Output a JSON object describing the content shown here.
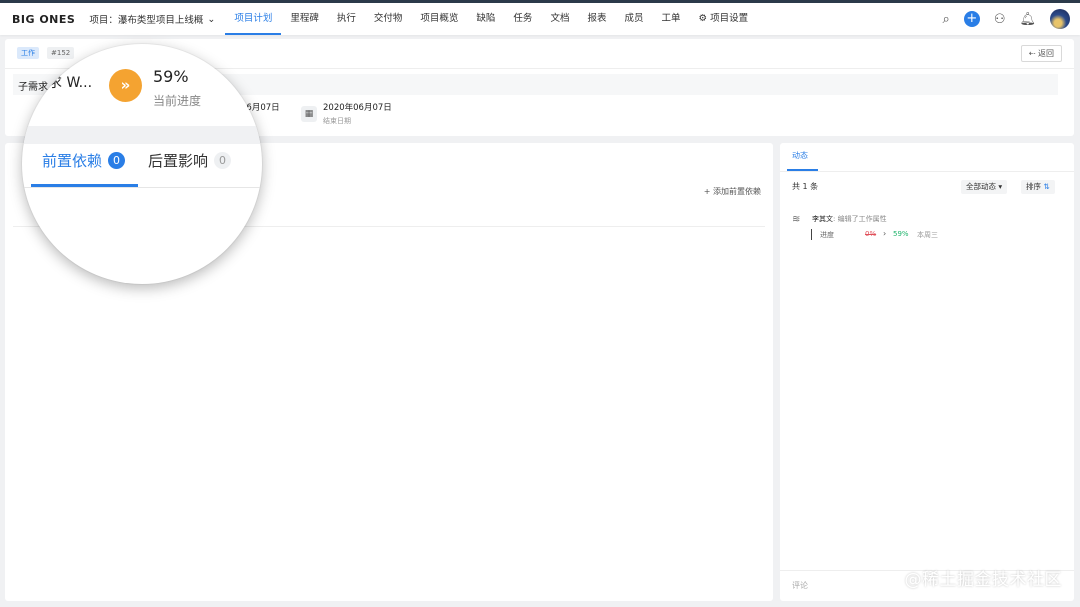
{
  "header": {
    "logo": "BIG ONES",
    "project": "项目：瀑布类型项目上线概",
    "nav": [
      "项目计划",
      "里程碑",
      "执行",
      "交付物",
      "项目概览",
      "缺陷",
      "任务",
      "文档",
      "报表",
      "成员",
      "工单"
    ],
    "settings": "项目设置",
    "accent": "#2a7ee6"
  },
  "task": {
    "type_tag": "工作",
    "id_tag": "#152",
    "back": "返回",
    "title": "子需求",
    "start_date": "06月07日",
    "end_date": "2020年06月07日",
    "end_label": "结束日期"
  },
  "main": {
    "add_dependency": "添加前置依赖"
  },
  "magnifier": {
    "title": "子需求 W...",
    "progress": "59%",
    "progress_label": "当前进度",
    "progress_color": "#f4a331",
    "tab_pre": "前置依赖",
    "tab_pre_count": "0",
    "tab_post": "后置影响",
    "tab_post_count": "0"
  },
  "activity": {
    "tab": "动态",
    "total": "共 1 条",
    "filter": "全部动态",
    "sort": "排序",
    "user": "李其文",
    "action": ": 编辑了工作属性",
    "field": "进度",
    "old_value": "0%",
    "new_value": "59%",
    "time": "本周三",
    "comment_placeholder": "评论"
  },
  "watermark": "@稀土掘金技术社区"
}
